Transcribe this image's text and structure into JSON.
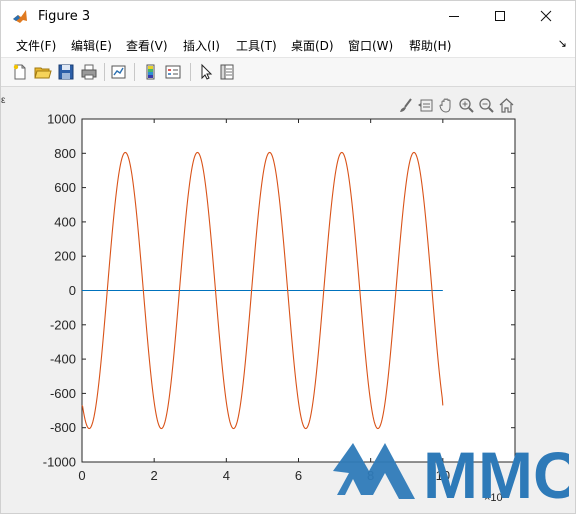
{
  "window": {
    "title": "Figure 3",
    "controls": [
      "minimize",
      "maximize",
      "close"
    ]
  },
  "menu": {
    "items": [
      "文件(F)",
      "编辑(E)",
      "查看(V)",
      "插入(I)",
      "工具(T)",
      "桌面(D)",
      "窗口(W)",
      "帮助(H)"
    ],
    "overflow_icon": "chevron-right-icon"
  },
  "toolbar": {
    "buttons": [
      "new-figure-icon",
      "open-file-icon",
      "save-icon",
      "print-icon",
      "link-plot-icon",
      "insert-colorbar-icon",
      "insert-legend-icon",
      "edit-plot-icon",
      "property-inspector-icon"
    ]
  },
  "axes_toolbar": {
    "buttons": [
      "brush-icon",
      "data-tips-icon",
      "pan-icon",
      "zoom-in-icon",
      "zoom-out-icon",
      "home-icon"
    ]
  },
  "watermark": {
    "text": "MMC",
    "color": "#2e7ab8"
  },
  "chart_data": {
    "type": "line",
    "x_multiplier_label": "×10",
    "x_ticks": [
      "0",
      "2",
      "4",
      "6",
      "8",
      "10"
    ],
    "y_ticks": [
      "1000",
      "800",
      "600",
      "400",
      "200",
      "0",
      "-200",
      "-400",
      "-600",
      "-800",
      "-1000"
    ],
    "xlim": [
      0,
      12
    ],
    "ylim": [
      -1000,
      1000
    ],
    "grid": false,
    "series": [
      {
        "color": "#0072bd",
        "x_range": [
          0,
          10
        ],
        "form": "constant",
        "value": 0
      },
      {
        "color": "#d95319",
        "x_range": [
          0,
          10
        ],
        "form": "sine",
        "amplitude": 805,
        "period": 2.0,
        "phase_zero_crossing_x": 0.7,
        "start_value": -670,
        "end_value": -670
      }
    ]
  }
}
